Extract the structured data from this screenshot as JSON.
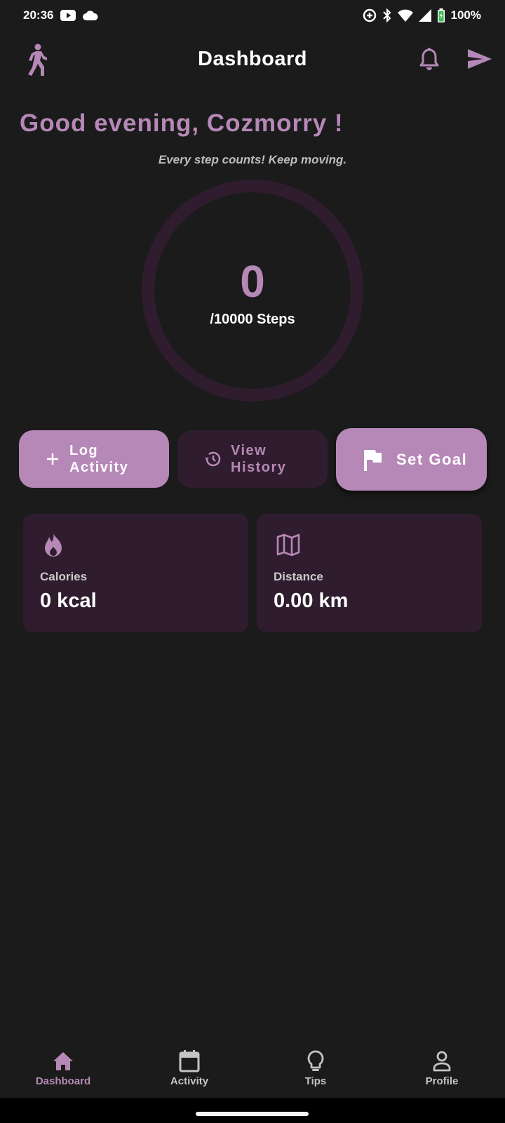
{
  "status": {
    "time": "20:36",
    "battery": "100%",
    "icons": [
      "youtube-icon",
      "cloud-icon",
      "data-saver-icon",
      "bluetooth-icon",
      "wifi-icon",
      "signal-icon",
      "battery-icon"
    ]
  },
  "app_bar": {
    "title": "Dashboard",
    "icons": [
      "walk-icon",
      "bell-icon",
      "send-icon"
    ]
  },
  "greeting": "Good evening, Cozmorry !",
  "motto": "Every step counts! Keep moving.",
  "steps": {
    "value": "0",
    "goal_label": "/10000 Steps",
    "progress": 0
  },
  "actions": {
    "log_line1": "Log",
    "log_line2": "Activity",
    "history_line1": "View",
    "history_line2": "History",
    "goal": "Set Goal"
  },
  "stats": {
    "calories_label": "Calories",
    "calories_value": "0 kcal",
    "distance_label": "Distance",
    "distance_value": "0.00 km"
  },
  "nav": {
    "items": [
      {
        "label": "Dashboard",
        "icon": "home-icon"
      },
      {
        "label": "Activity",
        "icon": "calendar-icon"
      },
      {
        "label": "Tips",
        "icon": "lightbulb-icon"
      },
      {
        "label": "Profile",
        "icon": "person-icon"
      }
    ],
    "active": "Dashboard"
  },
  "colors": {
    "background": "#1b1b1b",
    "accent": "#b688b7",
    "surface": "#2f1d2f",
    "text": "#ffffff"
  }
}
